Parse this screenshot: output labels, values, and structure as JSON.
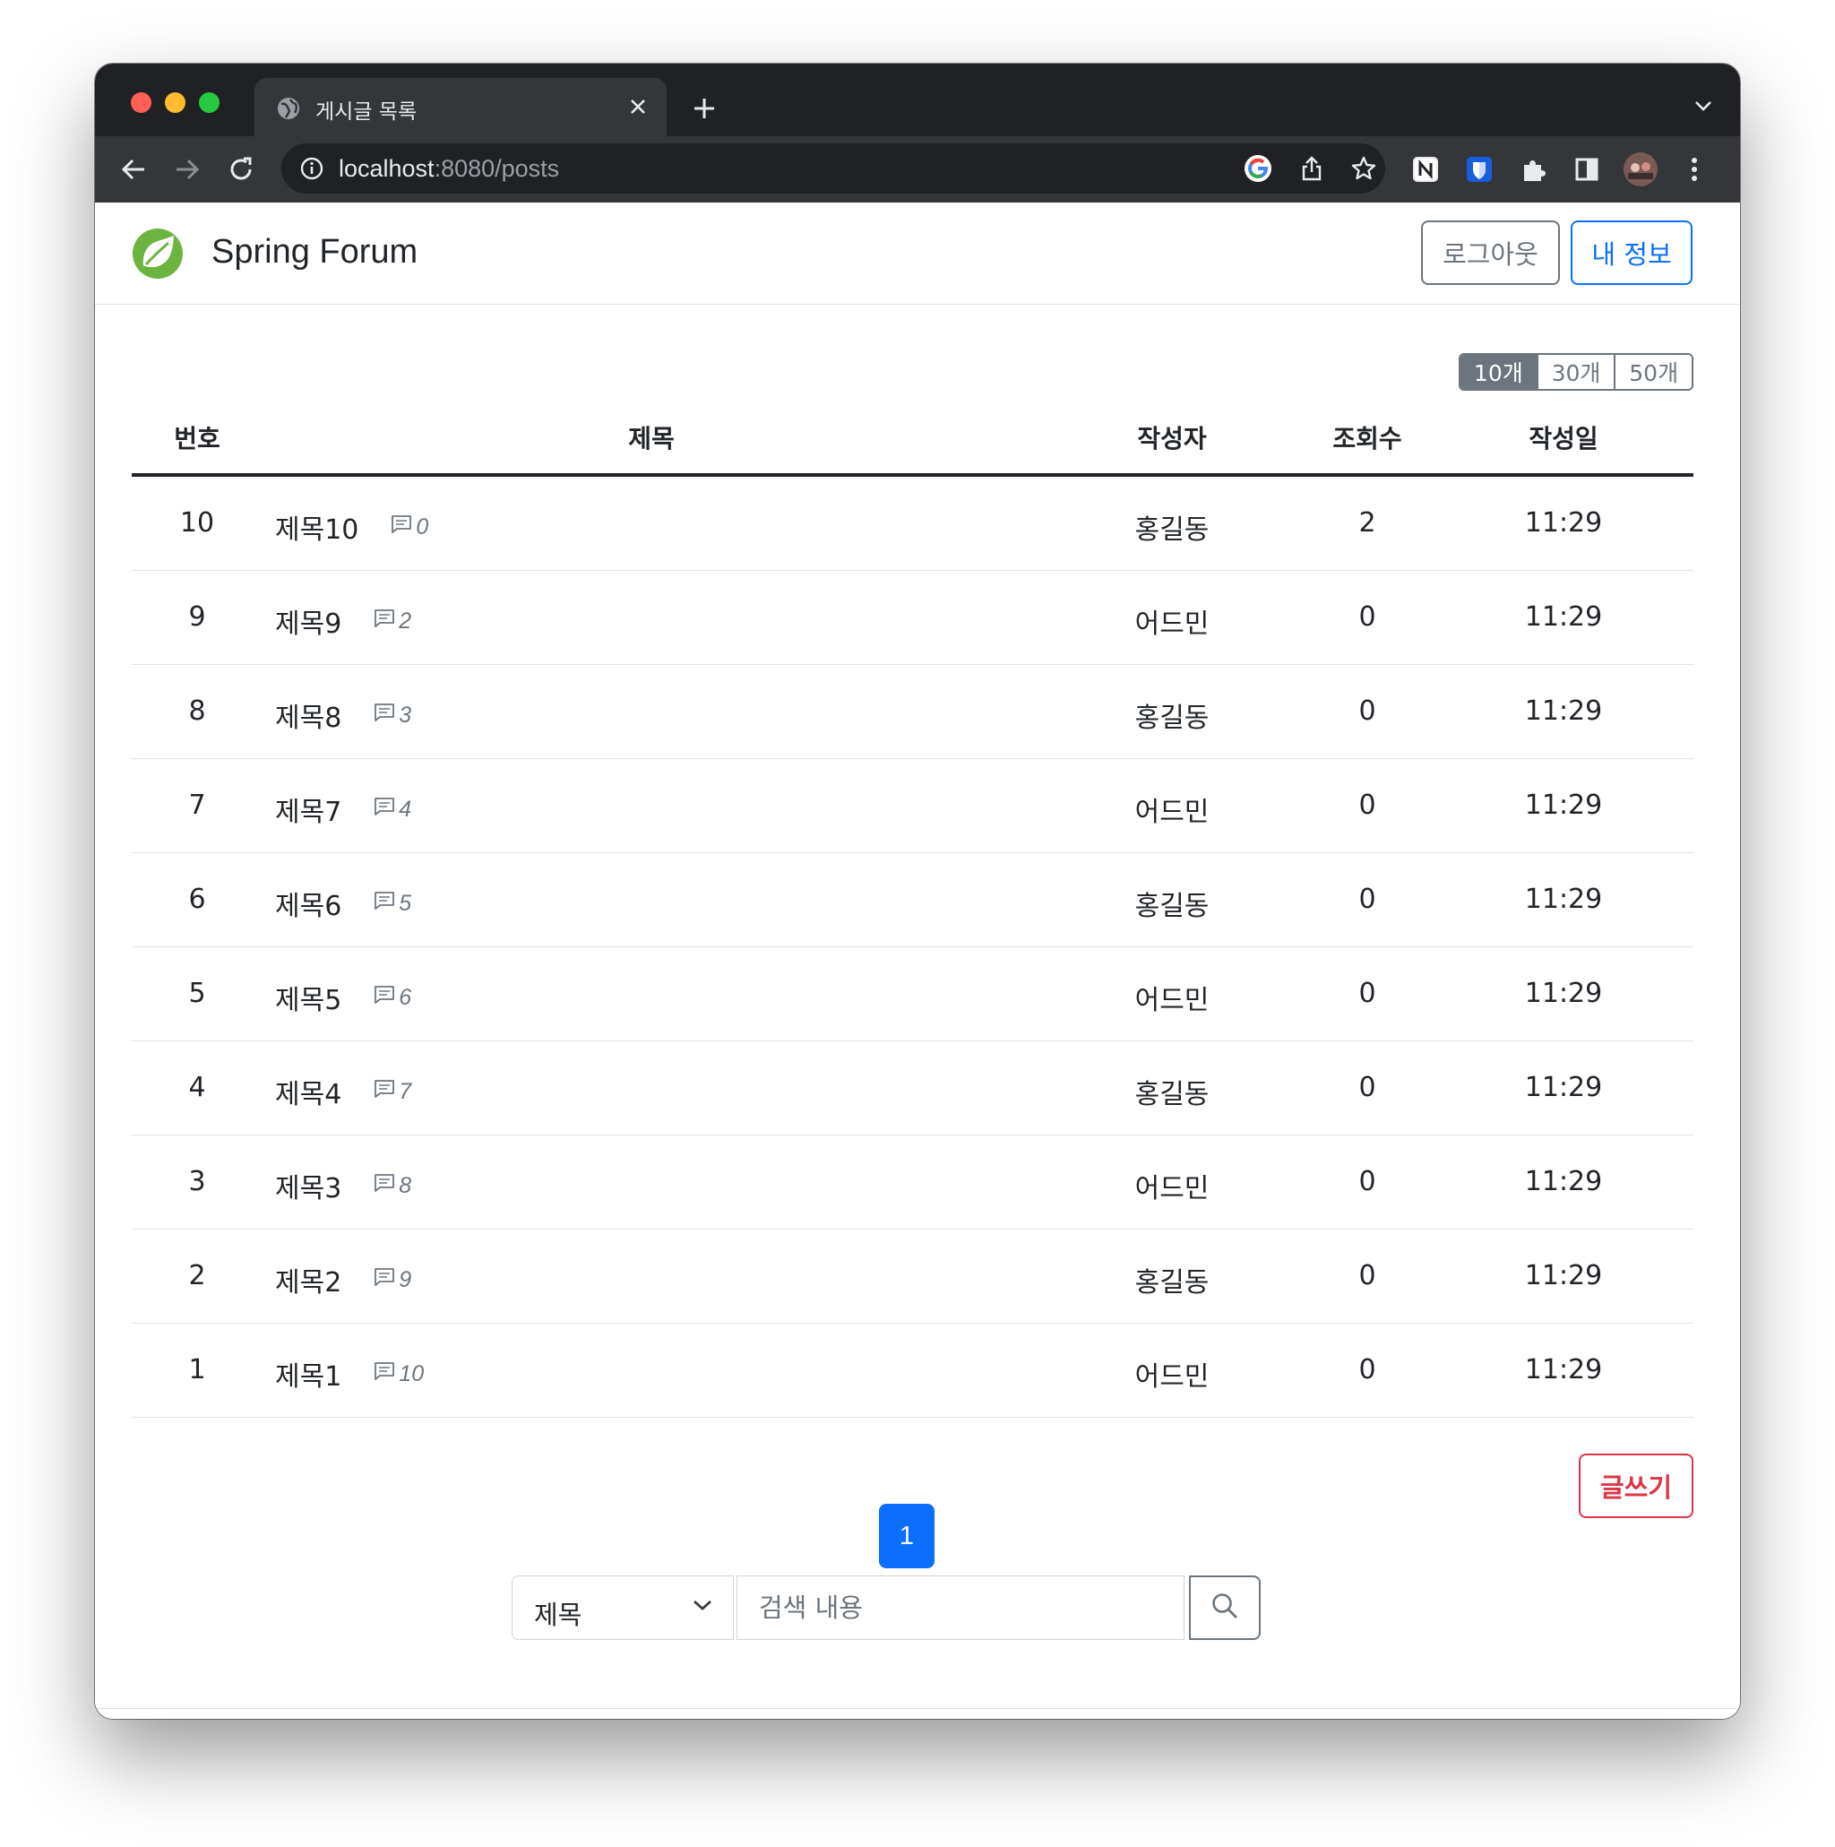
{
  "browser": {
    "tab_title": "게시글 목록",
    "url_host": "localhost",
    "url_rest": ":8080/posts"
  },
  "header": {
    "brand": "Spring Forum",
    "logout_label": "로그아웃",
    "myinfo_label": "내 정보"
  },
  "page_size": {
    "options": [
      "10개",
      "30개",
      "50개"
    ],
    "selected": "10개"
  },
  "table": {
    "headers": {
      "num": "번호",
      "title": "제목",
      "author": "작성자",
      "views": "조회수",
      "date": "작성일"
    },
    "rows": [
      {
        "num": "10",
        "title": "제목10",
        "comments": "0",
        "author": "홍길동",
        "views": "2",
        "date": "11:29"
      },
      {
        "num": "9",
        "title": "제목9",
        "comments": "2",
        "author": "어드민",
        "views": "0",
        "date": "11:29"
      },
      {
        "num": "8",
        "title": "제목8",
        "comments": "3",
        "author": "홍길동",
        "views": "0",
        "date": "11:29"
      },
      {
        "num": "7",
        "title": "제목7",
        "comments": "4",
        "author": "어드민",
        "views": "0",
        "date": "11:29"
      },
      {
        "num": "6",
        "title": "제목6",
        "comments": "5",
        "author": "홍길동",
        "views": "0",
        "date": "11:29"
      },
      {
        "num": "5",
        "title": "제목5",
        "comments": "6",
        "author": "어드민",
        "views": "0",
        "date": "11:29"
      },
      {
        "num": "4",
        "title": "제목4",
        "comments": "7",
        "author": "홍길동",
        "views": "0",
        "date": "11:29"
      },
      {
        "num": "3",
        "title": "제목3",
        "comments": "8",
        "author": "어드민",
        "views": "0",
        "date": "11:29"
      },
      {
        "num": "2",
        "title": "제목2",
        "comments": "9",
        "author": "홍길동",
        "views": "0",
        "date": "11:29"
      },
      {
        "num": "1",
        "title": "제목1",
        "comments": "10",
        "author": "어드민",
        "views": "0",
        "date": "11:29"
      }
    ]
  },
  "write_label": "글쓰기",
  "pagination": {
    "current": "1"
  },
  "search": {
    "field_value": "제목",
    "placeholder": "검색 내용"
  },
  "colors": {
    "primary": "#0d6efd",
    "secondary": "#6c757d",
    "danger": "#dc3545",
    "chrome_dark": "#202124",
    "chrome_toolbar": "#35363a"
  },
  "icons": {
    "tab": "globe-icon",
    "comment": "chat-left-text-icon",
    "search": "search-icon"
  }
}
